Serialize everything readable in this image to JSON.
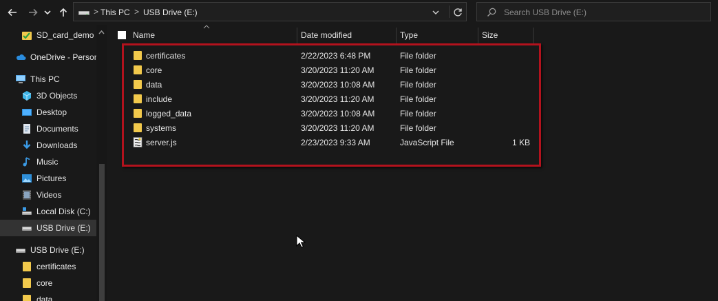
{
  "toolbar": {
    "back": "back-arrow-icon",
    "forward": "forward-arrow-icon",
    "recent": "chevron-down-icon",
    "up": "up-arrow-icon"
  },
  "address": {
    "crumbs": [
      "This PC",
      "USB Drive (E:)"
    ],
    "separator": ">"
  },
  "search": {
    "placeholder": "Search USB Drive (E:)"
  },
  "sidebar": {
    "items": [
      {
        "label": "SD_card_demo",
        "icon": "green-check-folder-icon"
      },
      {
        "label": "OneDrive - Person",
        "icon": "onedrive-cloud-icon"
      },
      {
        "label": "This PC",
        "icon": "computer-icon"
      },
      {
        "label": "3D Objects",
        "icon": "cube-icon"
      },
      {
        "label": "Desktop",
        "icon": "desktop-icon"
      },
      {
        "label": "Documents",
        "icon": "documents-icon"
      },
      {
        "label": "Downloads",
        "icon": "download-arrow-icon"
      },
      {
        "label": "Music",
        "icon": "music-note-icon"
      },
      {
        "label": "Pictures",
        "icon": "pictures-icon"
      },
      {
        "label": "Videos",
        "icon": "film-icon"
      },
      {
        "label": "Local Disk (C:)",
        "icon": "local-disk-icon"
      },
      {
        "label": "USB Drive (E:)",
        "icon": "usb-drive-icon",
        "selected": true
      },
      {
        "label": "USB Drive (E:)",
        "icon": "usb-drive-icon"
      },
      {
        "label": "certificates",
        "icon": "folder-icon"
      },
      {
        "label": "core",
        "icon": "folder-icon"
      },
      {
        "label": "data",
        "icon": "folder-icon"
      }
    ]
  },
  "columns": {
    "name": "Name",
    "date": "Date modified",
    "type": "Type",
    "size": "Size"
  },
  "files": [
    {
      "name": "certificates",
      "date": "2/22/2023 6:48 PM",
      "type": "File folder",
      "size": "",
      "icon": "folder-icon"
    },
    {
      "name": "core",
      "date": "3/20/2023 11:20 AM",
      "type": "File folder",
      "size": "",
      "icon": "folder-icon"
    },
    {
      "name": "data",
      "date": "3/20/2023 10:08 AM",
      "type": "File folder",
      "size": "",
      "icon": "folder-icon"
    },
    {
      "name": "include",
      "date": "3/20/2023 11:20 AM",
      "type": "File folder",
      "size": "",
      "icon": "folder-icon"
    },
    {
      "name": "logged_data",
      "date": "3/20/2023 10:08 AM",
      "type": "File folder",
      "size": "",
      "icon": "folder-icon"
    },
    {
      "name": "systems",
      "date": "3/20/2023 11:20 AM",
      "type": "File folder",
      "size": "",
      "icon": "folder-icon"
    },
    {
      "name": "server.js",
      "date": "2/23/2023 9:33 AM",
      "type": "JavaScript File",
      "size": "1 KB",
      "icon": "javascript-file-icon"
    }
  ],
  "colors": {
    "folder": "#f2c94c",
    "highlight": "#b3121d",
    "selection": "#333333",
    "background": "#191919"
  }
}
